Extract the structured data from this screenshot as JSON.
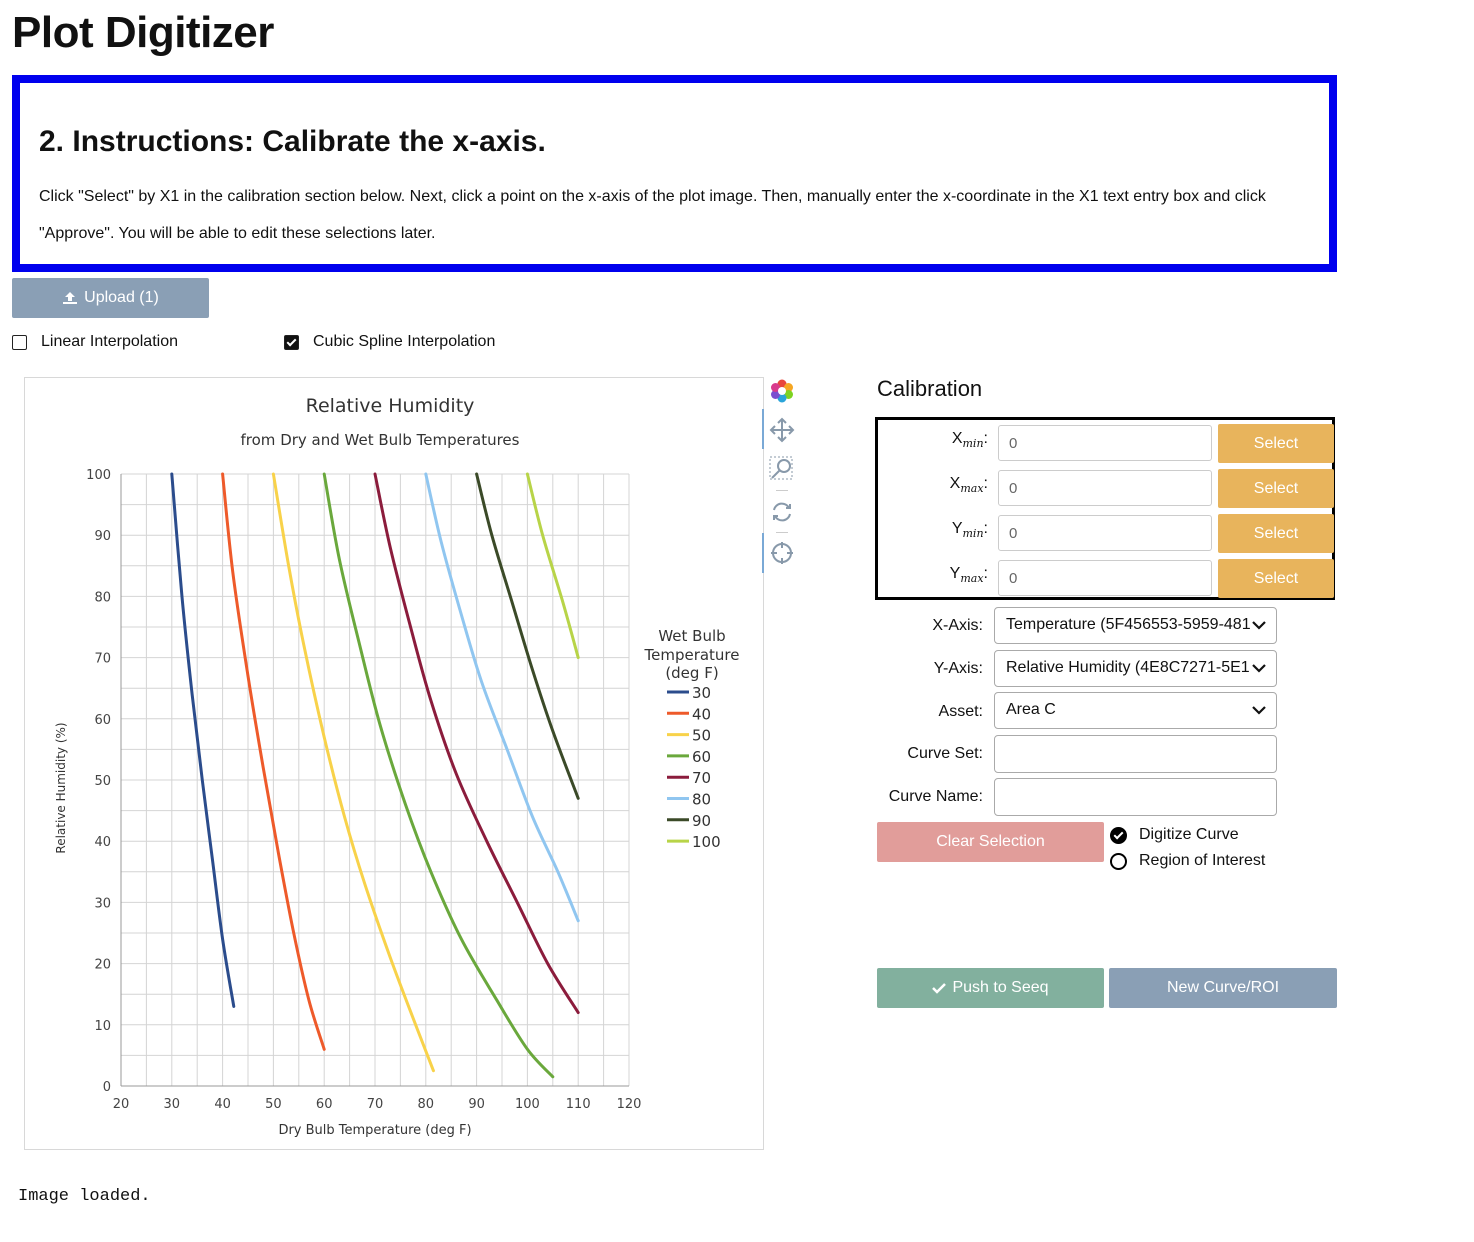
{
  "page": {
    "title": "Plot Digitizer"
  },
  "instructions": {
    "heading": "2. Instructions: Calibrate the x-axis.",
    "text": "Click \"Select\" by X1 in the calibration section below. Next, click a point on the x-axis of the plot image. Then, manually enter the x-coordinate in the X1 text entry box and click \"Approve\". You will be able to edit these selections later."
  },
  "upload": {
    "label": "Upload (1)",
    "icon": "upload-icon"
  },
  "options": {
    "linear": {
      "label": "Linear Interpolation",
      "checked": false
    },
    "cubic": {
      "label": "Cubic Spline Interpolation",
      "checked": true
    }
  },
  "toolbar": {
    "tools": [
      "plotly-logo-icon",
      "pan-icon",
      "zoom-box-icon",
      "reset-axes-icon",
      "crosshair-icon"
    ]
  },
  "calibration": {
    "title": "Calibration",
    "rows": [
      {
        "label": "X",
        "sub": "min",
        "value": "0",
        "button": "Select"
      },
      {
        "label": "X",
        "sub": "max",
        "value": "0",
        "button": "Select"
      },
      {
        "label": "Y",
        "sub": "min",
        "value": "0",
        "button": "Select"
      },
      {
        "label": "Y",
        "sub": "max",
        "value": "0",
        "button": "Select"
      }
    ],
    "x_axis": {
      "label": "X-Axis:",
      "value": "Temperature (5F456553-5959-481"
    },
    "y_axis": {
      "label": "Y-Axis:",
      "value": "Relative Humidity (4E8C7271-5E1"
    },
    "asset": {
      "label": "Asset:",
      "value": "Area C"
    },
    "curve_set": {
      "label": "Curve Set:",
      "value": ""
    },
    "curve_name": {
      "label": "Curve Name:",
      "value": ""
    },
    "clear_label": "Clear Selection",
    "mode_digitize": "Digitize Curve",
    "mode_roi": "Region of Interest",
    "selected_mode": "digitize",
    "push_label": "Push to Seeq",
    "new_label": "New Curve/ROI",
    "colors": {
      "select": "#e8b45c",
      "clear": "#e19d9a",
      "push": "#82b09e",
      "new": "#8a9fb5"
    }
  },
  "status": "Image loaded.",
  "chart_data": {
    "type": "line",
    "title": "Relative Humidity",
    "subtitle": "from Dry and Wet Bulb Temperatures",
    "xlabel": "Dry Bulb Temperature (deg F)",
    "ylabel": "Relative Humidity (%)",
    "xlim": [
      20,
      120
    ],
    "ylim": [
      0,
      100
    ],
    "xticks": [
      20,
      30,
      40,
      50,
      60,
      70,
      80,
      90,
      100,
      110,
      120
    ],
    "yticks": [
      0,
      10,
      20,
      30,
      40,
      50,
      60,
      70,
      80,
      90,
      100
    ],
    "grid": true,
    "legend_title": "Wet Bulb Temperature (deg F)",
    "legend_position": "right",
    "series": [
      {
        "name": "30",
        "color": "#2b4c8c",
        "x": [
          30,
          32,
          34,
          36,
          38,
          40,
          42.2
        ],
        "y": [
          100,
          80,
          64,
          50,
          37,
          24,
          13
        ]
      },
      {
        "name": "40",
        "color": "#ee5a2a",
        "x": [
          40,
          42,
          45,
          48,
          51,
          54,
          57,
          60
        ],
        "y": [
          100,
          84,
          67,
          52,
          38,
          25,
          14,
          6
        ]
      },
      {
        "name": "50",
        "color": "#f8d24a",
        "x": [
          50,
          53,
          56,
          60,
          64,
          68,
          73,
          78,
          81.5
        ],
        "y": [
          100,
          85,
          72,
          57,
          44,
          33,
          21,
          10,
          2.5
        ]
      },
      {
        "name": "60",
        "color": "#6aa83c",
        "x": [
          60,
          63,
          67,
          71,
          76,
          81,
          87,
          94,
          100,
          105
        ],
        "y": [
          100,
          86,
          72,
          59,
          46,
          35,
          24,
          14,
          6,
          1.5
        ]
      },
      {
        "name": "70",
        "color": "#8b1c3c",
        "x": [
          70,
          73,
          77,
          81,
          86,
          92,
          98,
          104,
          110
        ],
        "y": [
          100,
          88,
          75,
          63,
          51,
          40,
          30,
          20,
          12
        ]
      },
      {
        "name": "80",
        "color": "#90c6f0",
        "x": [
          80,
          83,
          87,
          91,
          96,
          101,
          106,
          110
        ],
        "y": [
          100,
          89,
          77,
          66,
          55,
          44,
          35,
          27
        ]
      },
      {
        "name": "90",
        "color": "#3b4a28",
        "x": [
          90,
          93,
          97,
          101,
          105,
          110
        ],
        "y": [
          100,
          90,
          79,
          68,
          58,
          47
        ]
      },
      {
        "name": "100",
        "color": "#b8d448",
        "x": [
          100,
          103,
          107,
          110
        ],
        "y": [
          100,
          90,
          79,
          70
        ]
      }
    ]
  }
}
